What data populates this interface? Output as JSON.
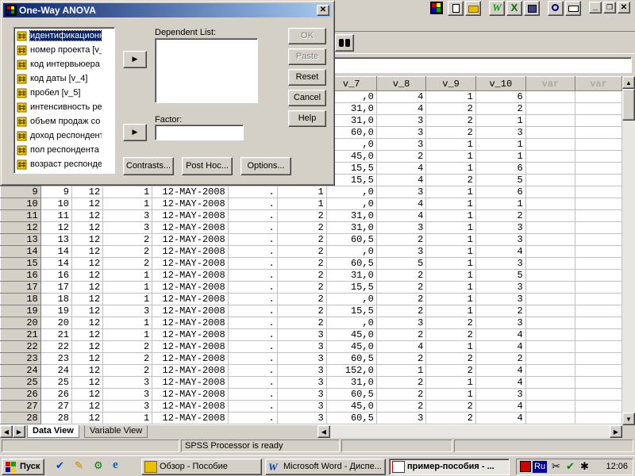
{
  "toolbar_icons": [
    "binoculars-icon",
    "file-icon",
    "folder-icon",
    "word-icon",
    "excel-icon",
    "save-icon",
    "zoom-icon",
    "mail-icon"
  ],
  "window_controls": {
    "minimize": "_",
    "restore": "❐",
    "close": "✕"
  },
  "grid": {
    "headers": [
      "v_7",
      "v_8",
      "v_9",
      "v_10",
      "var",
      "var"
    ],
    "top_rows": [
      [
        ",0",
        "4",
        "1",
        "6"
      ],
      [
        "31,0",
        "4",
        "2",
        "2"
      ],
      [
        "31,0",
        "3",
        "2",
        "1"
      ],
      [
        "60,0",
        "3",
        "2",
        "3"
      ],
      [
        ",0",
        "3",
        "1",
        "1"
      ],
      [
        "45,0",
        "2",
        "1",
        "1"
      ],
      [
        "15,5",
        "4",
        "1",
        "6"
      ],
      [
        "15,5",
        "4",
        "2",
        "5"
      ]
    ],
    "rows": [
      [
        "9",
        "9",
        "12",
        "1",
        "12-MAY-2008",
        ".",
        "1",
        ",0",
        "3",
        "1",
        "6"
      ],
      [
        "10",
        "10",
        "12",
        "1",
        "12-MAY-2008",
        ".",
        "1",
        ",0",
        "4",
        "1",
        "1"
      ],
      [
        "11",
        "11",
        "12",
        "3",
        "12-MAY-2008",
        ".",
        "2",
        "31,0",
        "4",
        "1",
        "2"
      ],
      [
        "12",
        "12",
        "12",
        "3",
        "12-MAY-2008",
        ".",
        "2",
        "31,0",
        "3",
        "1",
        "3"
      ],
      [
        "13",
        "13",
        "12",
        "2",
        "12-MAY-2008",
        ".",
        "2",
        "60,5",
        "2",
        "1",
        "3"
      ],
      [
        "14",
        "14",
        "12",
        "2",
        "12-MAY-2008",
        ".",
        "2",
        ",0",
        "3",
        "1",
        "4"
      ],
      [
        "15",
        "14",
        "12",
        "2",
        "12-MAY-2008",
        ".",
        "2",
        "60,5",
        "5",
        "1",
        "3"
      ],
      [
        "16",
        "16",
        "12",
        "1",
        "12-MAY-2008",
        ".",
        "2",
        "31,0",
        "2",
        "1",
        "5"
      ],
      [
        "17",
        "17",
        "12",
        "1",
        "12-MAY-2008",
        ".",
        "2",
        "15,5",
        "2",
        "1",
        "3"
      ],
      [
        "18",
        "18",
        "12",
        "1",
        "12-MAY-2008",
        ".",
        "2",
        ",0",
        "2",
        "1",
        "3"
      ],
      [
        "19",
        "19",
        "12",
        "3",
        "12-MAY-2008",
        ".",
        "2",
        "15,5",
        "2",
        "1",
        "2"
      ],
      [
        "20",
        "20",
        "12",
        "1",
        "12-MAY-2008",
        ".",
        "2",
        ",0",
        "3",
        "2",
        "3"
      ],
      [
        "21",
        "21",
        "12",
        "1",
        "12-MAY-2008",
        ".",
        "3",
        "45,0",
        "2",
        "2",
        "4"
      ],
      [
        "22",
        "22",
        "12",
        "2",
        "12-MAY-2008",
        ".",
        "3",
        "45,0",
        "4",
        "1",
        "4"
      ],
      [
        "23",
        "23",
        "12",
        "2",
        "12-MAY-2008",
        ".",
        "3",
        "60,5",
        "2",
        "2",
        "2"
      ],
      [
        "24",
        "24",
        "12",
        "2",
        "12-MAY-2008",
        ".",
        "3",
        "152,0",
        "1",
        "2",
        "4"
      ],
      [
        "25",
        "25",
        "12",
        "3",
        "12-MAY-2008",
        ".",
        "3",
        "31,0",
        "2",
        "1",
        "4"
      ],
      [
        "26",
        "26",
        "12",
        "3",
        "12-MAY-2008",
        ".",
        "3",
        "60,5",
        "2",
        "1",
        "3"
      ],
      [
        "27",
        "27",
        "12",
        "3",
        "12-MAY-2008",
        ".",
        "3",
        "45,0",
        "2",
        "2",
        "4"
      ],
      [
        "28",
        "28",
        "12",
        "1",
        "12-MAY-2008",
        ".",
        "3",
        "60,5",
        "3",
        "2",
        "4"
      ]
    ]
  },
  "tabs": {
    "data_view": "Data View",
    "variable_view": "Variable View"
  },
  "status": {
    "processor": "SPSS Processor  is ready"
  },
  "taskbar": {
    "start": "Пуск",
    "tasks": [
      "Обзор - Пособие",
      "Microsoft Word - Диспе...",
      "пример-пособия - ..."
    ],
    "lang": "Ru",
    "clock": "12:06"
  },
  "dialog": {
    "title": "One-Way ANOVA",
    "close_glyph": "✕",
    "variables": [
      "идентификационн",
      "номер проекта [v_",
      "код интервьюера",
      "код даты [v_4]",
      "пробел [v_5]",
      "интенсивность ре",
      "объем продаж со",
      "доход респондент",
      "пол респондента",
      "возраст респонде"
    ],
    "dependent_label": "Dependent List:",
    "factor_label": "Factor:",
    "arrow": "▶",
    "buttons": {
      "ok": "OK",
      "paste": "Paste",
      "reset": "Reset",
      "cancel": "Cancel",
      "help": "Help",
      "contrasts": "Contrasts...",
      "posthoc": "Post Hoc...",
      "options": "Options..."
    }
  },
  "colors": {
    "title_start": "#0a246a",
    "title_end": "#a6caf0",
    "face": "#d4d0c8"
  }
}
